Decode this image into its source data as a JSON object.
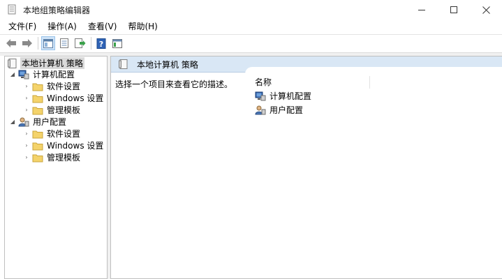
{
  "window": {
    "title": "本地组策略编辑器",
    "minimize_icon": "minimize-icon",
    "maximize_icon": "maximize-icon",
    "close_icon": "close-icon"
  },
  "menu": [
    "文件(F)",
    "操作(A)",
    "查看(V)",
    "帮助(H)"
  ],
  "toolbar": {
    "buttons": [
      "back-arrow-icon",
      "forward-arrow-icon",
      "show-hide-tree-icon",
      "properties-icon",
      "export-list-icon",
      "help-icon",
      "extended-view-icon"
    ]
  },
  "tree": {
    "root": "本地计算机 策略",
    "computer_config": "计算机配置",
    "user_config": "用户配置",
    "software_settings": "软件设置",
    "windows_settings": "Windows 设置",
    "admin_templates": "管理模板"
  },
  "right": {
    "header_title": "本地计算机 策略",
    "description": "选择一个项目来查看它的描述。",
    "column_name": "名称",
    "items": [
      "计算机配置",
      "用户配置"
    ]
  },
  "colors": {
    "header_bg": "#d9e7f5",
    "folder": "#f4d36b",
    "selection": "#d9d9d9"
  }
}
